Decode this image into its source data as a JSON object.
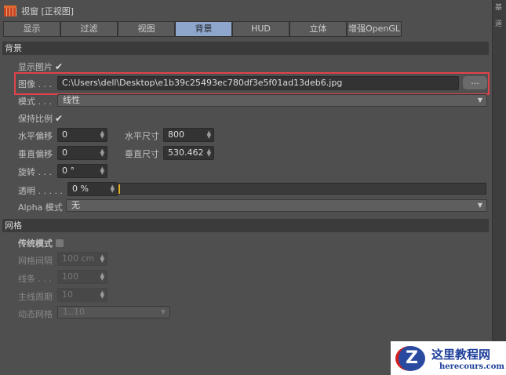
{
  "window": {
    "title": "视窗 [正视图]"
  },
  "tabs": [
    "显示",
    "过滤",
    "视图",
    "背景",
    "HUD",
    "立体",
    "增强OpenGL"
  ],
  "side_labels": [
    "基",
    "道"
  ],
  "background": {
    "section": "背景",
    "show_image_label": "显示图片",
    "show_image_check": "✔",
    "image_label": "图像 . . .",
    "image_path": "C:\\Users\\dell\\Desktop\\e1b39c25493ec780df3e5f01ad13deb6.jpg",
    "browse_label": "...",
    "mode_label": "模式 . . .",
    "mode_value": "线性",
    "keep_ratio_label": "保持比例",
    "keep_ratio_check": "✔",
    "h_offset_label": "水平偏移",
    "h_offset": "0",
    "v_offset_label": "垂直偏移",
    "v_offset": "0",
    "h_size_label": "水平尺寸",
    "h_size": "800",
    "v_size_label": "垂直尺寸",
    "v_size": "530.462",
    "rotation_label": "旋转 . . .",
    "rotation": "0 °",
    "transparency_label": "透明 . . . . .",
    "transparency": "0 %",
    "transparency_value": 0,
    "alpha_label": "Alpha 模式",
    "alpha_value": "无"
  },
  "grid": {
    "section": "网格",
    "legacy_label": "传统模式",
    "spacing_label": "网格间隔",
    "spacing": "100 cm",
    "lines_label": "线条 . . .",
    "lines": "100",
    "major_label": "主线周期",
    "major": "10",
    "dynamic_label": "动态网格",
    "dynamic": "1..10"
  },
  "watermark": {
    "cn": "这里教程网",
    "en": "herecours.com",
    "letter": "Z"
  }
}
